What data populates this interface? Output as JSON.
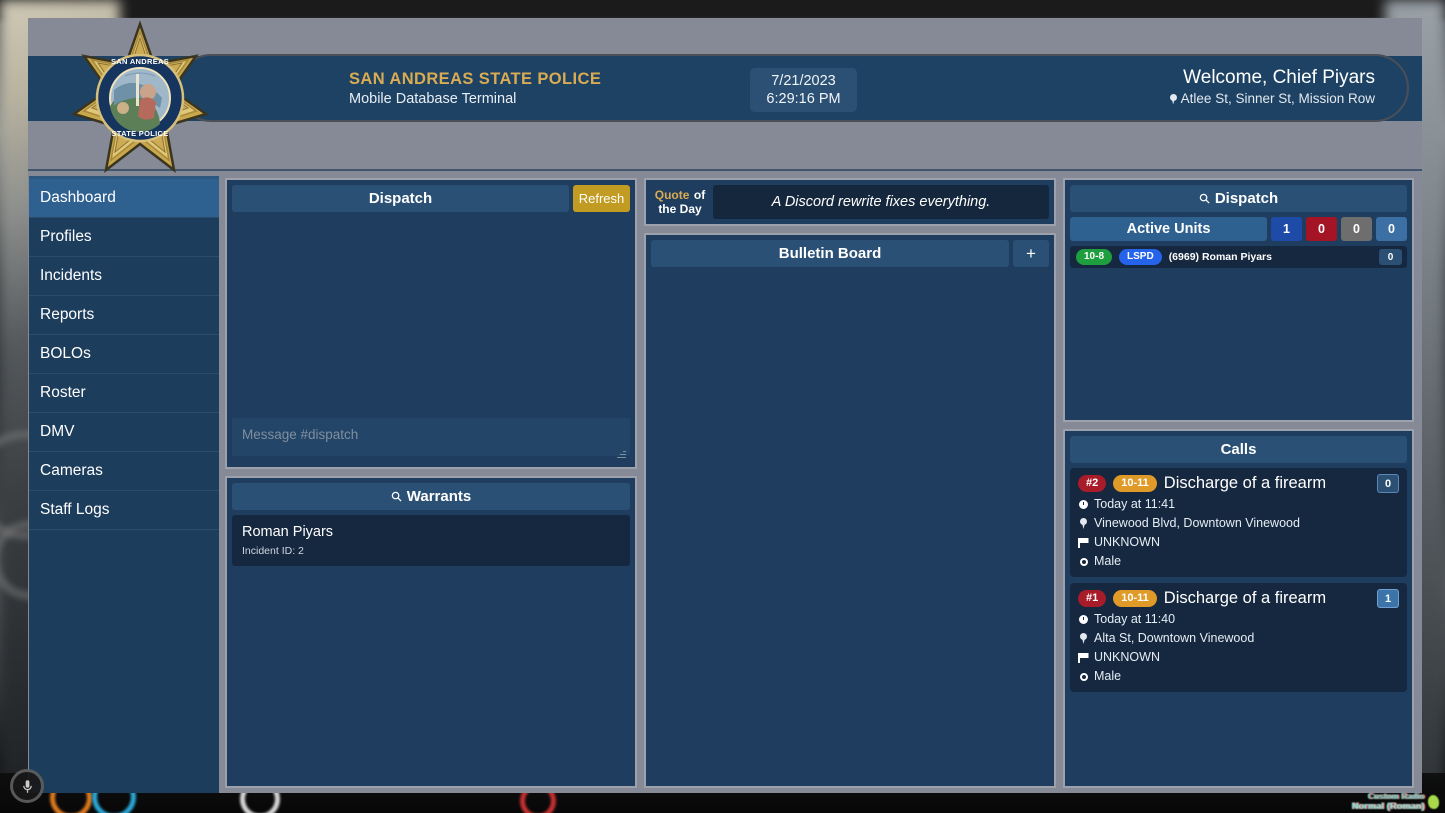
{
  "header": {
    "org_title": "SAN ANDREAS STATE POLICE",
    "org_subtitle": "Mobile Database Terminal",
    "badge_icon": "police-star-badge-icon",
    "date": "7/21/2023",
    "time": "6:29:16 PM",
    "welcome": "Welcome, Chief Piyars",
    "location": "Atlee St, Sinner St, Mission Row",
    "location_icon": "map-pin-icon"
  },
  "sidebar": {
    "items": [
      {
        "label": "Dashboard",
        "active": true
      },
      {
        "label": "Profiles",
        "active": false
      },
      {
        "label": "Incidents",
        "active": false
      },
      {
        "label": "Reports",
        "active": false
      },
      {
        "label": "BOLOs",
        "active": false
      },
      {
        "label": "Roster",
        "active": false
      },
      {
        "label": "DMV",
        "active": false
      },
      {
        "label": "Cameras",
        "active": false
      },
      {
        "label": "Staff Logs",
        "active": false
      }
    ]
  },
  "dispatch": {
    "title": "Dispatch",
    "refresh_label": "Refresh",
    "message_placeholder": "Message #dispatch",
    "message_value": ""
  },
  "warrants": {
    "title": "Warrants",
    "search_icon": "magnifier-icon",
    "items": [
      {
        "name": "Roman Piyars",
        "meta": "Incident ID: 2"
      }
    ]
  },
  "quote": {
    "label_line1_gold": "Quote",
    "label_line1_white": "of",
    "label_line2": "the Day",
    "text": "A Discord rewrite fixes everything."
  },
  "bulletin": {
    "title": "Bulletin Board",
    "add_label": "+",
    "add_icon": "plus-icon"
  },
  "right_dispatch": {
    "title": "Dispatch",
    "search_icon": "magnifier-icon",
    "active_units_label": "Active Units",
    "counts": [
      {
        "value": "1",
        "color": "#1e4ba8"
      },
      {
        "value": "0",
        "color": "#a41424"
      },
      {
        "value": "0",
        "color": "#6e6e6e"
      },
      {
        "value": "0",
        "color": "#3c6fa3"
      }
    ],
    "units": [
      {
        "status": "10-8",
        "status_color": "#1e9e3e",
        "dept": "LSPD",
        "dept_color": "#2563eb",
        "name": "(6969) Roman Piyars",
        "count": "0"
      }
    ]
  },
  "calls": {
    "title": "Calls",
    "items": [
      {
        "number": "#2",
        "code": "10-11",
        "title": "Discharge of a firearm",
        "count": "0",
        "count_variant": "c0",
        "time": "Today at 11:41",
        "time_icon": "clock-icon",
        "location": "Vinewood Blvd, Downtown Vinewood",
        "location_icon": "map-pin-icon",
        "postal": "UNKNOWN",
        "postal_icon": "flag-icon",
        "gender": "Male",
        "gender_icon": "circle-icon"
      },
      {
        "number": "#1",
        "code": "10-11",
        "title": "Discharge of a firearm",
        "count": "1",
        "count_variant": "c1",
        "time": "Today at 11:40",
        "time_icon": "clock-icon",
        "location": "Alta St, Downtown Vinewood",
        "location_icon": "map-pin-icon",
        "postal": "UNKNOWN",
        "postal_icon": "flag-icon",
        "gender": "Male",
        "gender_icon": "circle-icon"
      }
    ]
  },
  "overlay": {
    "mic_icon": "microphone-icon",
    "voice_status_top": "Custom Radio",
    "voice_status_bottom": "Normal (Roman)",
    "voice_icon": "voice-indicator-icon"
  },
  "theme": {
    "panel_bg": "#1f3d5e",
    "panel_border": "#9ca1ab",
    "header_bg": "#1e4263",
    "accent_gold": "#d9ab52",
    "nav_active": "#2f6190",
    "dark_card": "#16283f"
  }
}
